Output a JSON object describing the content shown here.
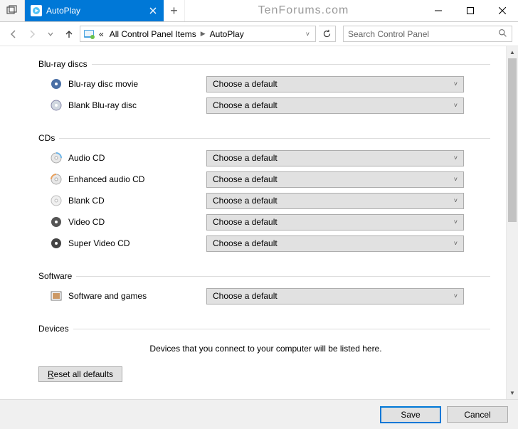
{
  "window": {
    "tab_title": "AutoPlay",
    "watermark": "TenForums.com"
  },
  "nav": {
    "breadcrumb_prefix": "«",
    "crumb1": "All Control Panel Items",
    "crumb2": "AutoPlay"
  },
  "search": {
    "placeholder": "Search Control Panel"
  },
  "combo_default": "Choose a default",
  "sections": {
    "bluray": {
      "title": "Blu-ray discs",
      "items": [
        {
          "label": "Blu-ray disc movie"
        },
        {
          "label": "Blank Blu-ray disc"
        }
      ]
    },
    "cds": {
      "title": "CDs",
      "items": [
        {
          "label": "Audio CD"
        },
        {
          "label": "Enhanced audio CD"
        },
        {
          "label": "Blank CD"
        },
        {
          "label": "Video CD"
        },
        {
          "label": "Super Video CD"
        }
      ]
    },
    "software": {
      "title": "Software",
      "items": [
        {
          "label": "Software and games"
        }
      ]
    },
    "devices": {
      "title": "Devices",
      "message": "Devices that you connect to your computer will be listed here."
    }
  },
  "buttons": {
    "reset_prefix": "R",
    "reset_rest": "eset all defaults",
    "save": "Save",
    "cancel": "Cancel"
  }
}
